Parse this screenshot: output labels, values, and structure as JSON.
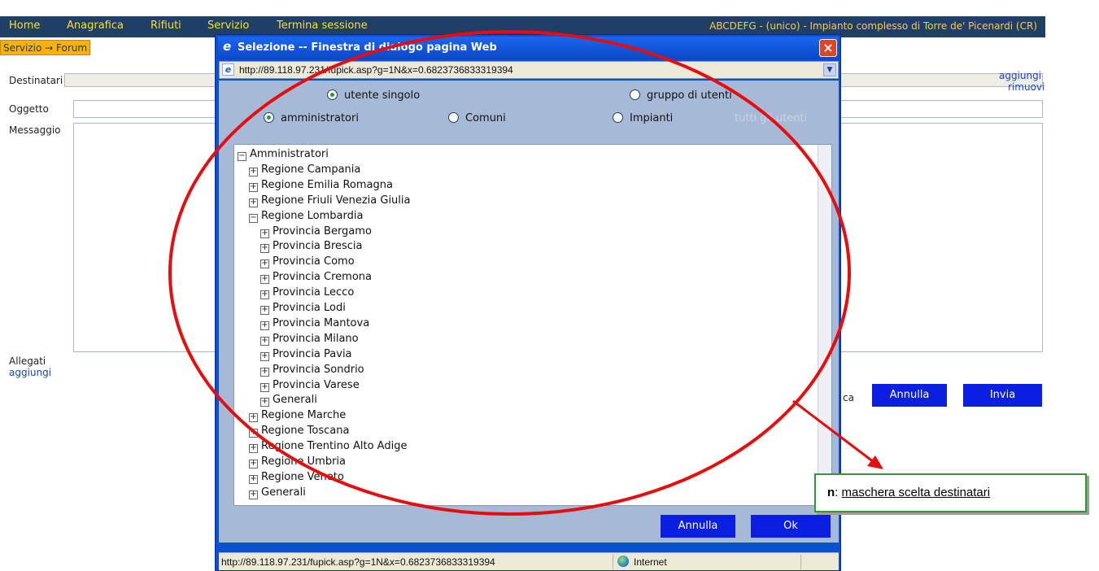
{
  "navbar": {
    "items": [
      "Home",
      "Anagrafica",
      "Rifiuti",
      "Servizio",
      "Termina sessione"
    ],
    "right_text": "ABCDEFG - (unico) - Impianto complesso di Torre de' Picenardi (CR)"
  },
  "breadcrumb": "Servizio → Forum",
  "form": {
    "destinatari_label": "Destinatari",
    "oggetto_label": "Oggetto",
    "messaggio_label": "Messaggio",
    "aggiungi_link": "aggiungi",
    "rimuovi_link": "rimuovi",
    "allegati_label": "Allegati",
    "allegati_aggiungi": "aggiungi",
    "partial_text": "ca",
    "annulla_button": "Annulla",
    "invia_button": "Invia"
  },
  "dialog": {
    "title": "Selezione -- Finestra di dialogo pagina Web",
    "address": "http://89.118.97.231/fupick.asp?g=1N&x=0.6823736833319394",
    "radio_utente_singolo": "utente singolo",
    "radio_gruppo_utenti": "gruppo di utenti",
    "radio_amministratori": "amministratori",
    "radio_comuni": "Comuni",
    "radio_impianti": "Impianti",
    "radio_tutti": "tutti gli utenti",
    "tree": [
      {
        "label": "Amministratori",
        "toggle": "−"
      },
      {
        "label": "Regione Campania",
        "toggle": "+"
      },
      {
        "label": "Regione Emilia Romagna",
        "toggle": "+"
      },
      {
        "label": "Regione Friuli Venezia Giulia",
        "toggle": "+"
      },
      {
        "label": "Regione Lombardia",
        "toggle": "−"
      },
      {
        "label": "Provincia Bergamo",
        "toggle": "+"
      },
      {
        "label": "Provincia Brescia",
        "toggle": "+"
      },
      {
        "label": "Provincia Como",
        "toggle": "+"
      },
      {
        "label": "Provincia Cremona",
        "toggle": "+"
      },
      {
        "label": "Provincia Lecco",
        "toggle": "+"
      },
      {
        "label": "Provincia Lodi",
        "toggle": "+"
      },
      {
        "label": "Provincia Mantova",
        "toggle": "+"
      },
      {
        "label": "Provincia Milano",
        "toggle": "+"
      },
      {
        "label": "Provincia Pavia",
        "toggle": "+"
      },
      {
        "label": "Provincia Sondrio",
        "toggle": "+"
      },
      {
        "label": "Provincia Varese",
        "toggle": "+"
      },
      {
        "label": "Generali",
        "toggle": "+"
      },
      {
        "label": "Regione Marche",
        "toggle": "+"
      },
      {
        "label": "Regione Toscana",
        "toggle": "+"
      },
      {
        "label": "Regione Trentino Alto Adige",
        "toggle": "+"
      },
      {
        "label": "Regione Umbria",
        "toggle": "+"
      },
      {
        "label": "Regione Veneto",
        "toggle": "+"
      },
      {
        "label": "Generali",
        "toggle": "+"
      }
    ],
    "annulla_button": "Annulla",
    "ok_button": "Ok",
    "status_url": "http://89.118.97.231/fupick.asp?g=1N&x=0.6823736833319394",
    "status_zone": "Internet"
  },
  "annotation": {
    "letter": "n",
    "text": "maschera scelta destinatari"
  },
  "colors": {
    "navbar": "#1f3f66",
    "nav_text": "#ffdd33",
    "breadcrumb": "#ffb000",
    "button_blue": "#0b1fe0",
    "annotation_red": "#e80c0c",
    "annotation_green": "#2f9a2f"
  }
}
